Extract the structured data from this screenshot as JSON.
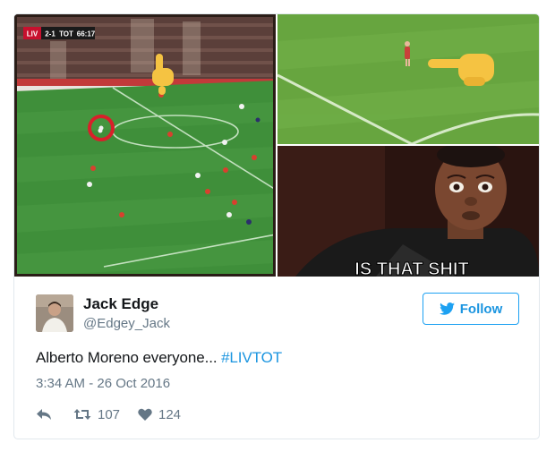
{
  "tweet": {
    "media": {
      "scoreboard": {
        "home_abbr": "LIV",
        "score": "2-1",
        "away_abbr": "TOT",
        "clock": "66:17"
      },
      "meme_caption": "IS THAT SHIT"
    },
    "author": {
      "name": "Jack Edge",
      "handle": "@Edgey_Jack"
    },
    "follow_label": "Follow",
    "text": "Alberto Moreno everyone... ",
    "hashtag": "#LIVTOT",
    "timestamp": "3:34 AM - 26 Oct 2016",
    "stats": {
      "retweets": "107",
      "likes": "124"
    },
    "colors": {
      "accent": "#1da1f2",
      "link": "#1b95e0",
      "muted": "#657786",
      "text": "#14171a",
      "pitch": "#3f8f3a",
      "highlight_circle": "#d8202a",
      "pointing_hand": "#f5c342"
    },
    "icons": [
      "pointing-hand-icon",
      "bird-icon",
      "reply-icon",
      "retweet-icon",
      "heart-icon"
    ]
  }
}
